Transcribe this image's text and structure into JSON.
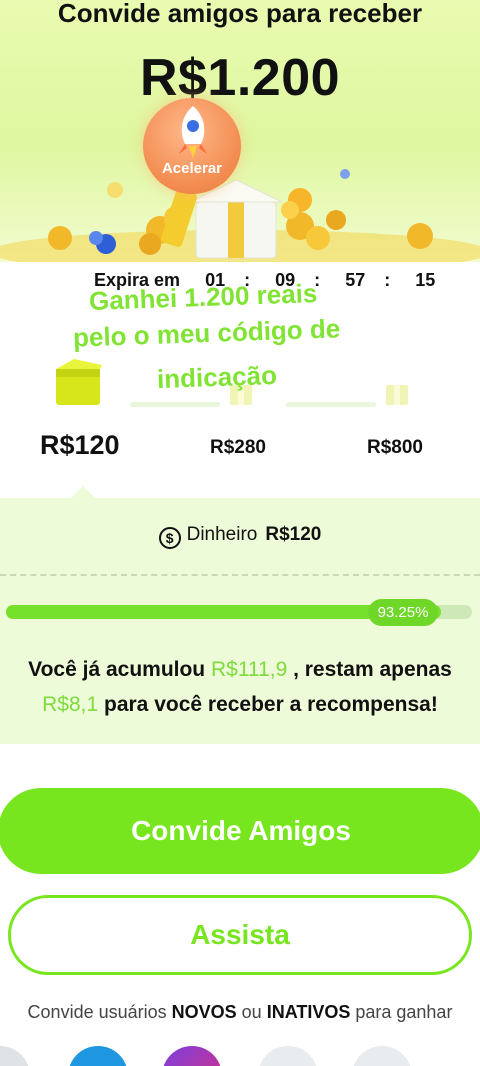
{
  "hero": {
    "title": "Convide amigos para receber",
    "amount": "R$1.200",
    "boost_label": "Acelerar"
  },
  "expiry": {
    "label": "Expira em",
    "hours": "01",
    "minutes": "09",
    "seconds": "57",
    "frames": "15",
    "sep": ":"
  },
  "overlay": {
    "line1": "Ganhei 1.200 reais",
    "line2": "pelo o meu código de",
    "line3": "indicação"
  },
  "milestones": [
    {
      "label": "R$120",
      "reached": true
    },
    {
      "label": "R$280",
      "reached": false
    },
    {
      "label": "R$800",
      "reached": false
    }
  ],
  "reward": {
    "coin_symbol": "$",
    "cash_label": "Dinheiro",
    "cash_amount": "R$120",
    "progress_percent_text": "93.25%",
    "progress_fraction": 0.9325,
    "msg_part1": "Você já acumulou ",
    "accumulated": "R$111,9",
    "msg_part2": " , restam apenas",
    "remaining": "R$8,1",
    "msg_part3": " para você receber a recompensa!"
  },
  "buttons": {
    "invite": "Convide Amigos",
    "watch": "Assista"
  },
  "footnote": {
    "part1": "Convide usuários ",
    "bold1": "NOVOS",
    "part2": " ou ",
    "bold2": "INATIVOS",
    "part3": " para ganhar"
  },
  "colors": {
    "accent": "#78e61f",
    "progress": "#76e12b",
    "highlight": "#7ddb3c",
    "boost": "#f28a4e"
  }
}
